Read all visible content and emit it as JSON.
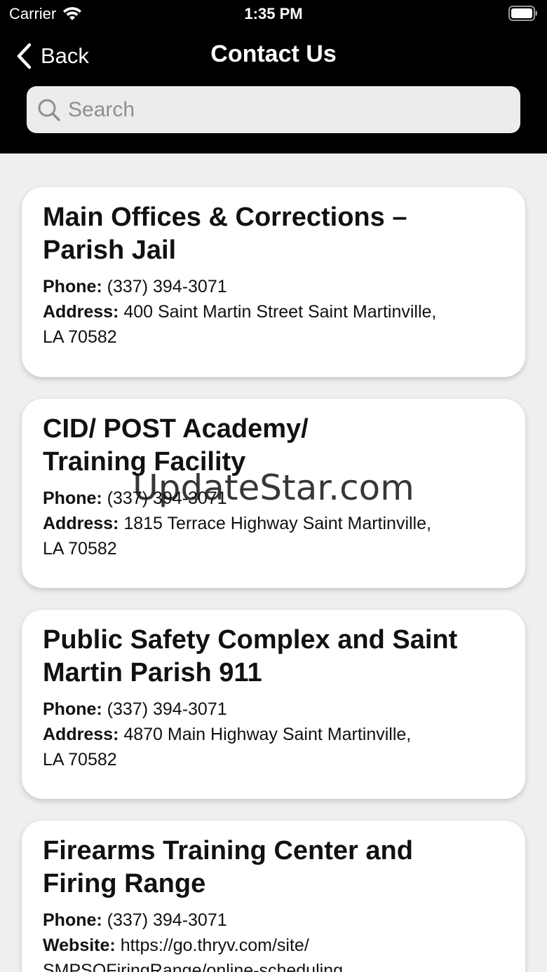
{
  "status_bar": {
    "carrier": "Carrier",
    "time": "1:35 PM"
  },
  "nav": {
    "back_label": "Back",
    "title": "Contact Us"
  },
  "search": {
    "placeholder": "Search",
    "value": ""
  },
  "labels": {
    "phone": "Phone:",
    "address": "Address:",
    "website": "Website:"
  },
  "contacts": [
    {
      "title_line1": "Main Offices & Corrections –",
      "title_line2": "Parish Jail",
      "phone": "(337) 394-3071",
      "address_line1": "400 Saint Martin Street  Saint Martinville,",
      "address_line2": "LA 70582"
    },
    {
      "title_line1": "CID/ POST Academy/",
      "title_line2": "Training Facility",
      "phone": "(337) 394-3071",
      "address_line1": "1815 Terrace Highway  Saint Martinville,",
      "address_line2": "LA 70582"
    },
    {
      "title_line1": "Public Safety Complex and Saint",
      "title_line2": "Martin Parish 911",
      "phone": "(337) 394-3071",
      "address_line1": "4870 Main Highway  Saint Martinville,",
      "address_line2": "LA 70582"
    },
    {
      "title_line1": "Firearms Training Center and",
      "title_line2": "Firing Range",
      "phone": "(337) 394-3071",
      "website_line1": "https://go.thryv.com/site/",
      "website_line2": "SMPSOFiringRange/online-scheduling"
    }
  ],
  "watermark": "UpdateStar.com",
  "colors": {
    "header_bg": "#000000",
    "page_bg": "#efefef",
    "card_bg": "#ffffff",
    "search_bg": "#ececec"
  }
}
